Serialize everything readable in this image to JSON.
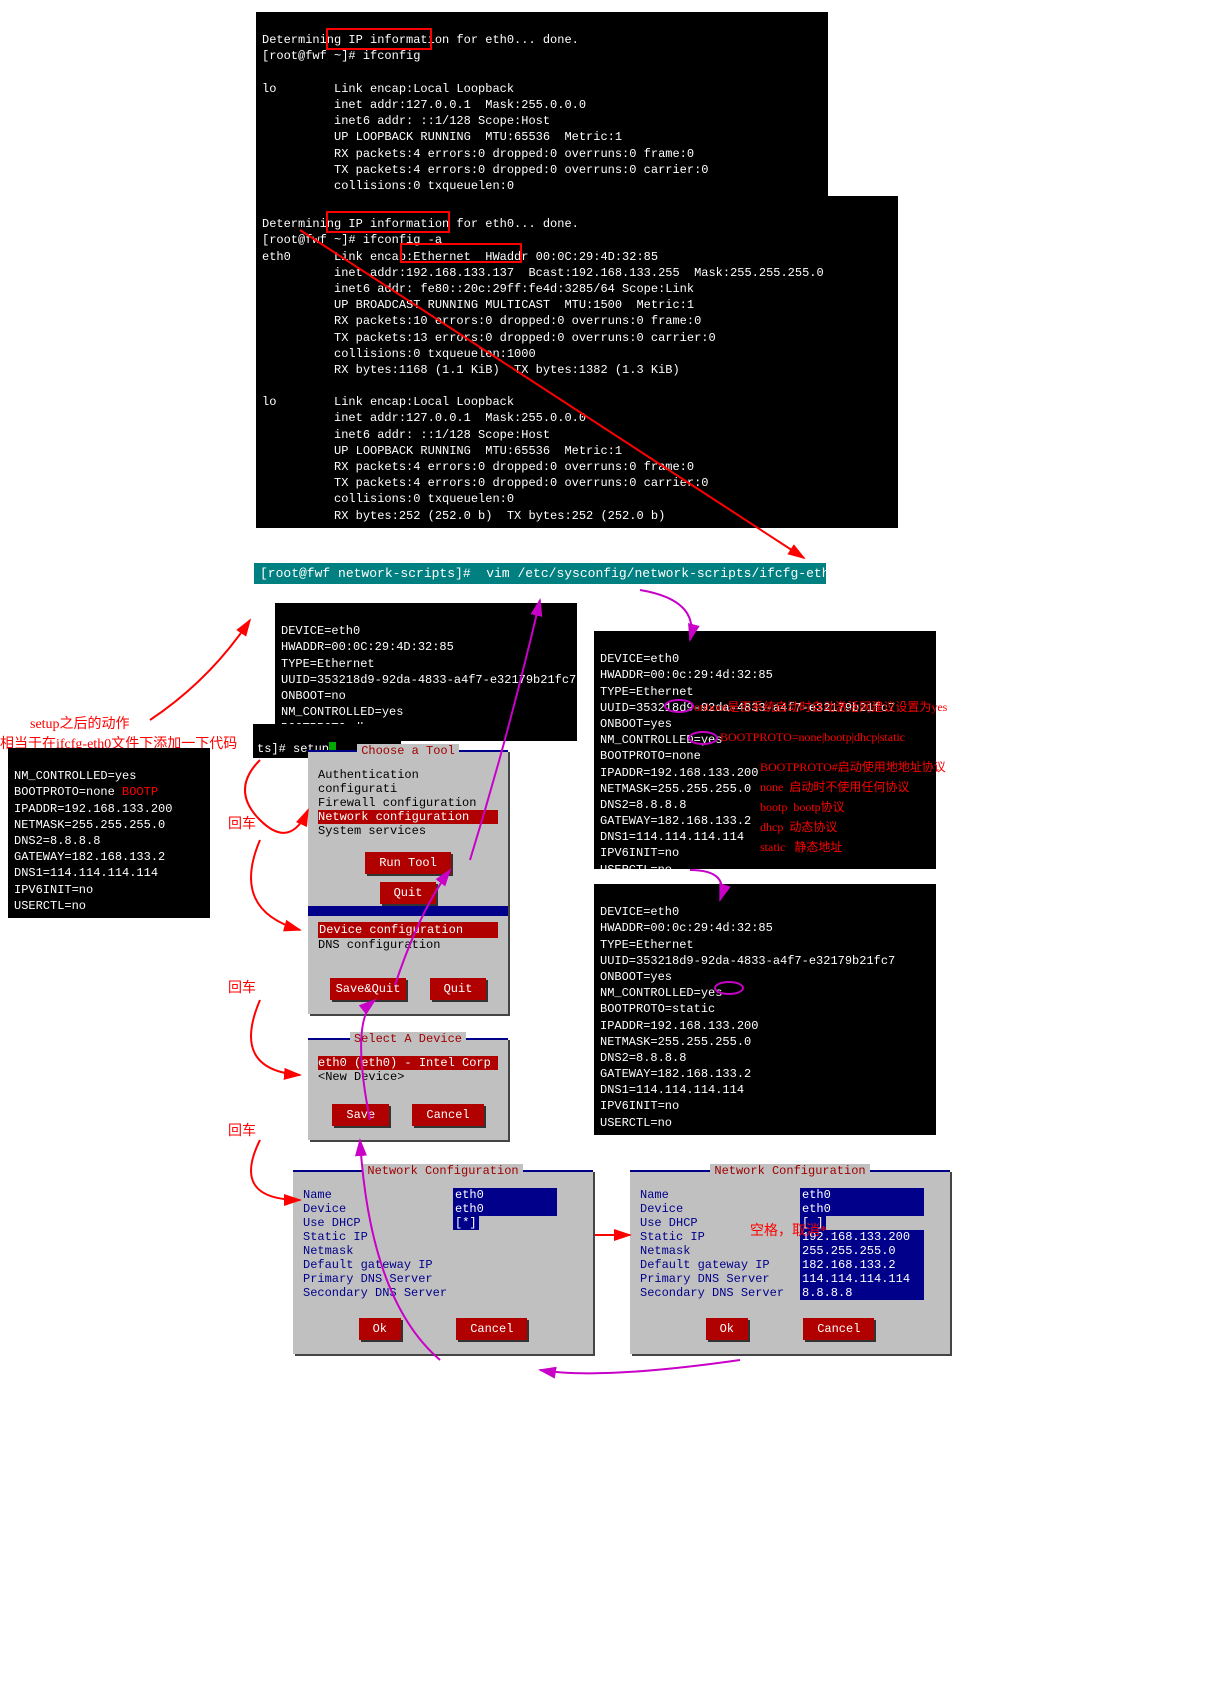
{
  "term1": {
    "l1": "Determining IP information for eth0... done.",
    "l2": "[root@fwf ~]# ifconfig",
    "lo": "lo        Link encap:Local Loopback",
    "lo2": "          inet addr:127.0.0.1  Mask:255.0.0.0",
    "lo3": "          inet6 addr: ::1/128 Scope:Host",
    "lo4": "          UP LOOPBACK RUNNING  MTU:65536  Metric:1",
    "lo5": "          RX packets:4 errors:0 dropped:0 overruns:0 frame:0",
    "lo6": "          TX packets:4 errors:0 dropped:0 overruns:0 carrier:0",
    "lo7": "          collisions:0 txqueuelen:0",
    "lo8": "          RX bytes:252 (252.0 b)  TX bytes:252 (252.0 b)"
  },
  "term2": {
    "l1": "Determining IP information for eth0... done.",
    "l2": "[root@fwf ~]# ifconfig -a",
    "e1": "eth0      Link encap:Ethernet  HWaddr 00:0C:29:4D:32:85",
    "e2": "          inet addr:192.168.133.137  Bcast:192.168.133.255  Mask:255.255.255.0",
    "e3": "          inet6 addr: fe80::20c:29ff:fe4d:3285/64 Scope:Link",
    "e4": "          UP BROADCAST RUNNING MULTICAST  MTU:1500  Metric:1",
    "e5": "          RX packets:10 errors:0 dropped:0 overruns:0 frame:0",
    "e6": "          TX packets:13 errors:0 dropped:0 overruns:0 carrier:0",
    "e7": "          collisions:0 txqueuelen:1000",
    "e8": "          RX bytes:1168 (1.1 KiB)  TX bytes:1382 (1.3 KiB)",
    "lo1": "lo        Link encap:Local Loopback",
    "lo2": "          inet addr:127.0.0.1  Mask:255.0.0.0",
    "lo3": "          inet6 addr: ::1/128 Scope:Host",
    "lo4": "          UP LOOPBACK RUNNING  MTU:65536  Metric:1",
    "lo5": "          RX packets:4 errors:0 dropped:0 overruns:0 frame:0",
    "lo6": "          TX packets:4 errors:0 dropped:0 overruns:0 carrier:0",
    "lo7": "          collisions:0 txqueuelen:0",
    "lo8": "          RX bytes:252 (252.0 b)  TX bytes:252 (252.0 b)"
  },
  "vimcmd": "[root@fwf network-scripts]#  vim /etc/sysconfig/network-scripts/ifcfg-eth0 ",
  "cfg1": {
    "l1": "DEVICE=eth0",
    "l2": "HWADDR=00:0C:29:4D:32:85",
    "l3": "TYPE=Ethernet",
    "l4": "UUID=353218d9-92da-4833-a4f7-e32179b21fc7",
    "l5": "ONBOOT=no",
    "l6": "NM_CONTROLLED=yes",
    "l7": "BOOTPROTO=dhcp"
  },
  "cfg2": {
    "l1": "DEVICE=eth0",
    "l2": "HWADDR=00:0c:29:4d:32:85",
    "l3": "TYPE=Ethernet",
    "l4": "UUID=353218d9-92da-4833-a4f7-e32179b21fc7",
    "l5": "ONBOOT=yes",
    "l6": "NM_CONTROLLED=yes",
    "l7": "BOOTPROTO=none",
    "l8": "IPADDR=192.168.133.200",
    "l9": "NETMASK=255.255.255.0",
    "l10": "DNS2=8.8.8.8",
    "l11": "GATEWAY=182.168.133.2",
    "l12": "DNS1=114.114.114.114",
    "l13": "IPV6INIT=no",
    "l14": "USERCTL=no",
    "a_onboot": "onboot是否系统启动时自动激活网建议设置为yes",
    "a_boot": "BOOTPROTO=none|bootp|dhcp|static",
    "a_l1": "BOOTPROTO#启动使用地地址协议",
    "a_l2": "none  启动时不使用任何协议",
    "a_l3": "bootp  bootp协议",
    "a_l4": "dhcp  动态协议",
    "a_l5": "static   静态地址"
  },
  "cfg3": {
    "l1": "DEVICE=eth0",
    "l2": "HWADDR=00:0c:29:4d:32:85",
    "l3": "TYPE=Ethernet",
    "l4": "UUID=353218d9-92da-4833-a4f7-e32179b21fc7",
    "l5": "ONBOOT=yes",
    "l6": "NM_CONTROLLED=yes",
    "l7": "BOOTPROTO=static",
    "l8": "IPADDR=192.168.133.200",
    "l9": "NETMASK=255.255.255.0",
    "l10": "DNS2=8.8.8.8",
    "l11": "GATEWAY=182.168.133.2",
    "l12": "DNS1=114.114.114.114",
    "l13": "IPV6INIT=no",
    "l14": "USERCTL=no"
  },
  "left_note1": "setup之后的动作",
  "left_note2": "相当于在ifcfg-eth0文件下添加一下代码",
  "leftcfg": {
    "l0": "NM_CONTROLLED=yes",
    "l1": "BOOTPROTO=none",
    "l2": "IPADDR=192.168.133.200",
    "l3": "NETMASK=255.255.255.0",
    "l4": "DNS2=8.8.8.8",
    "l5": "GATEWAY=182.168.133.2",
    "l6": "DNS1=114.114.114.114",
    "l7": "IPV6INIT=no",
    "l8": "USERCTL=no",
    "bootp": "BOOTP"
  },
  "setupcmd": "ts]# setup",
  "dialog1": {
    "title": "Choose a Tool",
    "i1": "Authentication configurati",
    "i2": "Firewall configuration",
    "i3": "Network configuration",
    "i4": "System services",
    "run": "Run Tool",
    "quit": "Quit"
  },
  "dialog2": {
    "i1": "Device configuration",
    "i2": "DNS configuration",
    "save": "Save&Quit",
    "quit": "Quit"
  },
  "dialog3": {
    "title": "Select A Device",
    "i1": "eth0 (eth0) - Intel Corp",
    "i2": "<New Device>",
    "save": "Save",
    "cancel": "Cancel"
  },
  "nc": {
    "title": "Network Configuration",
    "name": "Name",
    "device": "Device",
    "dhcp": "Use DHCP",
    "static": "Static IP",
    "netmask": "Netmask",
    "gw": "Default gateway IP",
    "dns1": "Primary DNS Server",
    "dns2": "Secondary DNS Server",
    "ok": "Ok",
    "cancel": "Cancel"
  },
  "ncA": {
    "name": "eth0",
    "device": "eth0",
    "dhcp": "[*]"
  },
  "ncB": {
    "name": "eth0",
    "device": "eth0",
    "dhcp": "[ ]",
    "static": "192.168.133.200",
    "netmask": "255.255.255.0",
    "gw": "182.168.133.2",
    "dns1": "114.114.114.114",
    "dns2": "8.8.8.8",
    "note": "空格，取消*"
  },
  "enter": "回车"
}
